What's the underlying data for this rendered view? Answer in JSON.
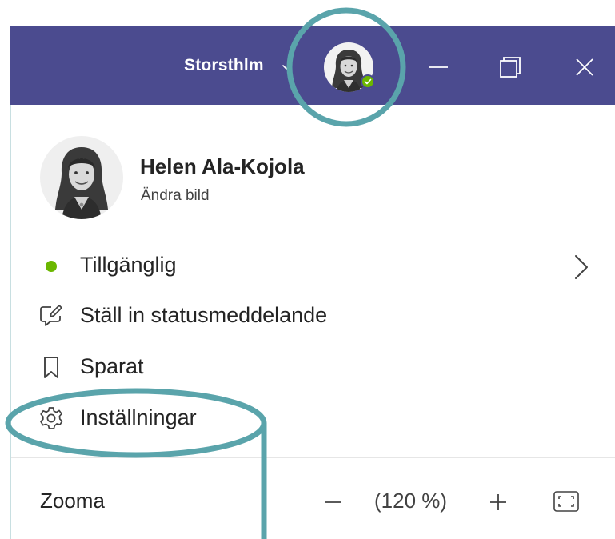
{
  "header": {
    "org_name": "Storsthlm",
    "avatar_status": "available"
  },
  "profile": {
    "name": "Helen Ala-Kojola",
    "change_photo": "Ändra bild"
  },
  "menu": {
    "available": "Tillgänglig",
    "set_status": "Ställ in statusmeddelande",
    "saved": "Sparat",
    "settings": "Inställningar"
  },
  "zoom": {
    "label": "Zooma",
    "value": "(120 %)"
  },
  "colors": {
    "titlebar": "#4b4b8f",
    "available_green": "#6bb700",
    "annotation_teal": "#5aa4ab"
  },
  "icons": {
    "org_chevron": "chevron-down-icon",
    "minimize": "minimize-icon",
    "restore": "restore-icon",
    "close": "close-icon",
    "status": "status-dot-icon",
    "set_status": "edit-message-icon",
    "saved": "bookmark-icon",
    "settings": "gear-icon",
    "submenu": "chevron-right-icon",
    "zoom_out": "minus-icon",
    "zoom_in": "plus-icon",
    "fullscreen": "fullscreen-icon"
  }
}
